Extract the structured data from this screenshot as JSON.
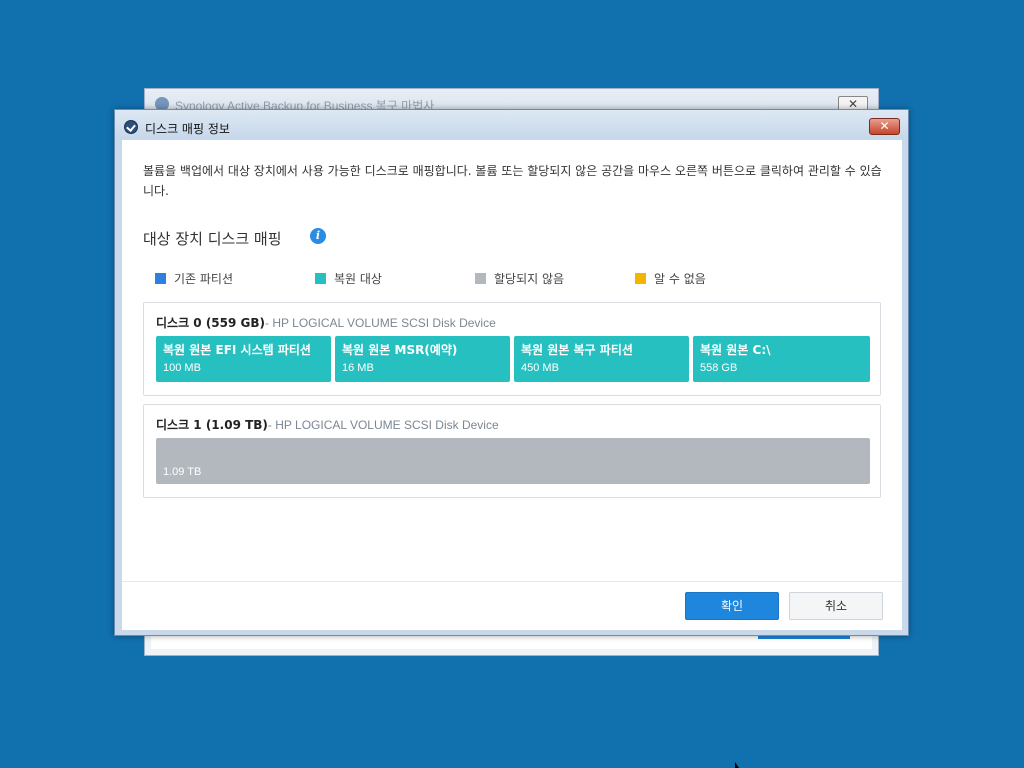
{
  "background_window": {
    "title": "Synology Active Backup for Business 복구 마법사",
    "close_label": "✕"
  },
  "dialog": {
    "title": "디스크 매핑 정보",
    "close_label": "✕",
    "description": "볼륨을 백업에서 대상 장치에서 사용 가능한 디스크로 매핑합니다. 볼륨 또는 할당되지 않은 공간을 마우스 오른쪽 버튼으로 클릭하여 관리할 수 있습니다.",
    "section_title": "대상 장치 디스크 매핑",
    "info_icon": "i",
    "legend": [
      {
        "label": "기존 파티션",
        "color": "#2f7fe0"
      },
      {
        "label": "복원 대상",
        "color": "#27c0c0"
      },
      {
        "label": "할당되지 않음",
        "color": "#b3b8bf"
      },
      {
        "label": "알 수 없음",
        "color": "#f5b400"
      }
    ],
    "disks": [
      {
        "name": "디스크 0 (559 GB)",
        "model": "- HP LOGICAL VOLUME SCSI Disk Device",
        "partitions": [
          {
            "name": "복원 원본 EFI 시스템 파티션",
            "size": "100 MB"
          },
          {
            "name": "복원 원본 MSR(예약)",
            "size": "16 MB"
          },
          {
            "name": "복원 원본 복구 파티션",
            "size": "450 MB"
          },
          {
            "name": "복원 원본 C:\\",
            "size": "558 GB"
          }
        ]
      },
      {
        "name": "디스크 1 (1.09 TB)",
        "model": "- HP LOGICAL VOLUME SCSI Disk Device",
        "unallocated_size": "1.09 TB"
      }
    ],
    "ok_label": "확인",
    "cancel_label": "취소"
  }
}
